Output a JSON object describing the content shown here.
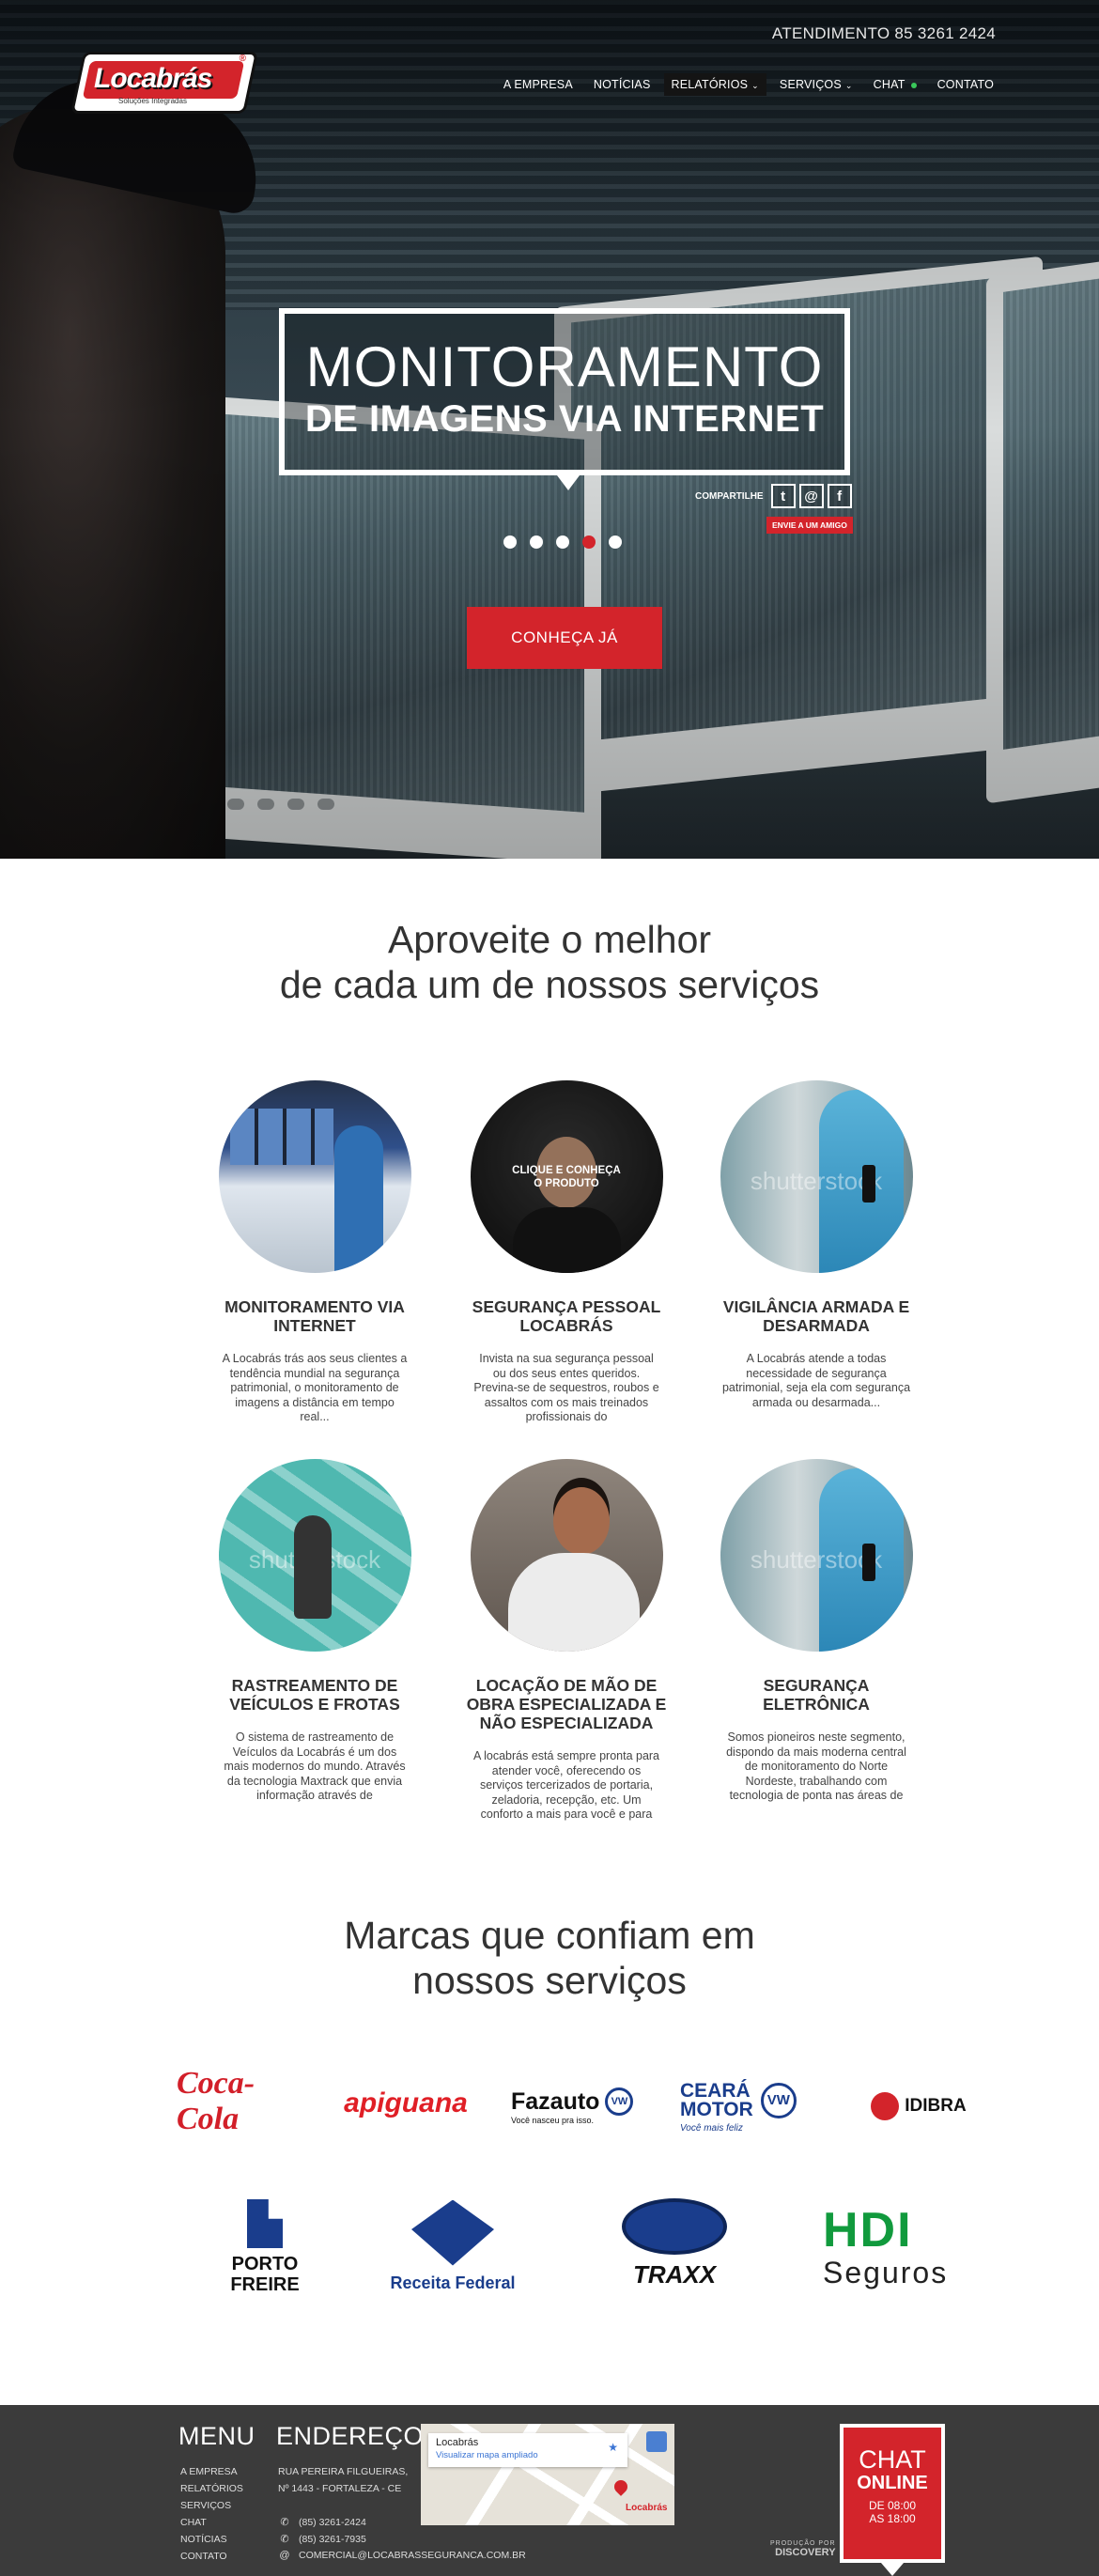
{
  "header": {
    "phone": "ATENDIMENTO 85 3261 2424",
    "logo_text": "Locabrás",
    "logo_sub": "Soluções Integradas",
    "nav": [
      {
        "label": "A EMPRESA"
      },
      {
        "label": "NOTÍCIAS"
      },
      {
        "label": "RELATÓRIOS"
      },
      {
        "label": "SERVIÇOS"
      },
      {
        "label": "CHAT"
      },
      {
        "label": "CONTATO"
      }
    ]
  },
  "hero": {
    "title_line1": "MONITORAMENTO",
    "title_line2": "DE IMAGENS VIA INTERNET",
    "share_label": "COMPARTILHE",
    "share_friend": "ENVIE A UM AMIGO",
    "slide_active": 4,
    "slide_count": 5,
    "cta": "CONHEÇA JÁ"
  },
  "services": {
    "heading_line1": "Aproveite o melhor",
    "heading_line2": "de cada um de nossos serviços",
    "hover_overlay_line1": "CLIQUE E CONHEÇA",
    "hover_overlay_line2": "O PRODUTO",
    "watermark": "shutterstock",
    "items": [
      {
        "title": "MONITORAMENTO VIA INTERNET",
        "text": "A Locabrás trás aos seus clientes a tendência mundial na segurança patrimonial, o monitoramento de imagens a distância em tempo real..."
      },
      {
        "title": "SEGURANÇA PESSOAL LOCABRÁS",
        "text": "Invista na sua segurança pessoal ou dos seus entes queridos. Previna-se de sequestros, roubos e assaltos com os mais treinados profissionais do"
      },
      {
        "title": "VIGILÂNCIA ARMADA E DESARMADA",
        "text": "A Locabrás atende a todas necessidade de segurança patrimonial, seja ela com segurança armada ou desarmada..."
      },
      {
        "title": "RASTREAMENTO DE VEÍCULOS E FROTAS",
        "text": "O sistema de rastreamento de Veículos da Locabrás é um dos mais modernos do mundo. Através da tecnologia Maxtrack que envia informação através de GSM/GPRS..."
      },
      {
        "title": "LOCAÇÃO DE MÃO DE OBRA ESPECIALIZADA E NÃO ESPECIALIZADA",
        "text": "A locabrás está sempre pronta para atender você, oferecendo os serviços tercerizados de portaria, zeladoria, recepção, etc. Um conforto a mais para você e para sua empresa..."
      },
      {
        "title": "SEGURANÇA ELETRÔNICA",
        "text": "Somos pioneiros neste segmento, dispondo da mais moderna central de monitoramento do Norte Nordeste, trabalhando com tecnologia de ponta nas áreas de"
      }
    ]
  },
  "brands": {
    "heading_line1": "Marcas que confiam em",
    "heading_line2": "nossos serviços",
    "coca_cola": "Coca-Cola",
    "apiguana": "apiguana",
    "fazauto": "Fazauto",
    "fazauto_tagline": "Você nasceu pra isso.",
    "ceara_line1": "CEARÁ",
    "ceara_line2": "MOTOR",
    "ceara_tagline": "Você mais feliz",
    "vw": "VW",
    "idibra": "IDIBRA",
    "porto_line1": "PORTO",
    "porto_line2": "FREIRE",
    "receita": "Receita Federal",
    "traxx": "TRAXX",
    "hdi": "HDI",
    "hdi_seguros": "Seguros"
  },
  "footer": {
    "menu_heading": "MENU",
    "menu_items": [
      "A EMPRESA",
      "RELATÓRIOS",
      "SERVIÇOS",
      "CHAT",
      "NOTÍCIAS",
      "CONTATO"
    ],
    "address_heading": "ENDEREÇO",
    "address_line1": "RUA PEREIRA FILGUEIRAS,",
    "address_line2": "Nº 1443 - FORTALEZA - CE",
    "phone1": "(85) 3261-2424",
    "phone2": "(85) 3261-7935",
    "email": "COMERCIAL@LOCABRASSEGURANCA.COM.BR",
    "map_title": "Locabrás",
    "map_link": "Visualizar mapa ampliado",
    "map_pin_label": "Locabrás",
    "credit_top": "PRODUÇÃO POR",
    "credit_name": "DISCOVERY",
    "chat_line1": "CHAT",
    "chat_line2": "ONLINE",
    "chat_line3": "DE 08:00",
    "chat_line4": "AS 18:00"
  }
}
